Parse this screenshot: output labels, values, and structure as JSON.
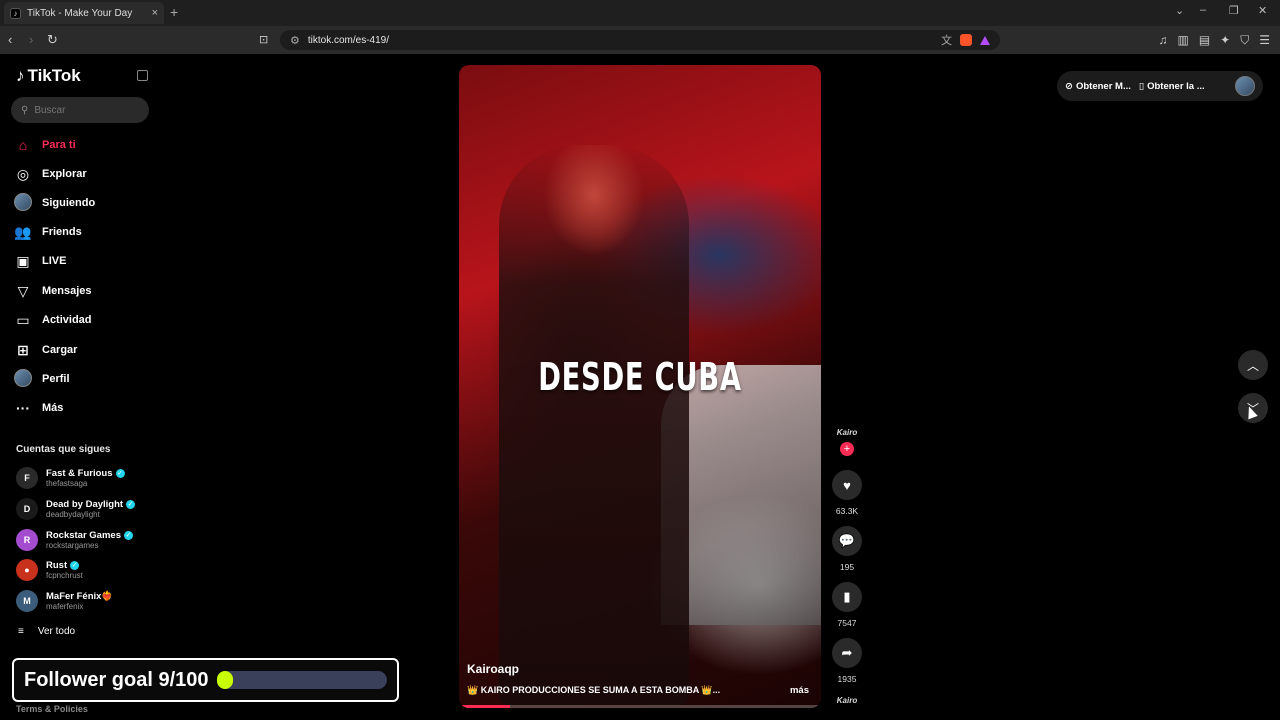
{
  "browser": {
    "tab_title": "TikTok - Make Your Day",
    "tab_close": "×",
    "new_tab": "+",
    "url": "tiktok.com/es-419/"
  },
  "sidebar": {
    "logo": "TikTok",
    "search_placeholder": "Buscar",
    "nav": [
      {
        "label": "Para ti",
        "icon": "home-icon",
        "glyph": "⌂",
        "active": true
      },
      {
        "label": "Explorar",
        "icon": "compass-icon",
        "glyph": "◎"
      },
      {
        "label": "Siguiendo",
        "icon": "avatar-icon",
        "glyph": ""
      },
      {
        "label": "Friends",
        "icon": "friends-icon",
        "glyph": "👥"
      },
      {
        "label": "LIVE",
        "icon": "live-icon",
        "glyph": "▣"
      },
      {
        "label": "Mensajes",
        "icon": "send-icon",
        "glyph": "▽"
      },
      {
        "label": "Actividad",
        "icon": "activity-icon",
        "glyph": "▭"
      },
      {
        "label": "Cargar",
        "icon": "upload-icon",
        "glyph": "⊞"
      },
      {
        "label": "Perfil",
        "icon": "profile-avatar-icon",
        "glyph": ""
      },
      {
        "label": "Más",
        "icon": "more-icon",
        "glyph": "···"
      }
    ],
    "following_title": "Cuentas que sigues",
    "following": [
      {
        "name": "Fast & Furious",
        "handle": "thefastsaga",
        "verified": true,
        "color": "#2a2a2a",
        "mark": "F"
      },
      {
        "name": "Dead by Daylight",
        "handle": "deadbydaylight",
        "verified": true,
        "color": "#1a1a1a",
        "mark": "D"
      },
      {
        "name": "Rockstar Games",
        "handle": "rockstargames",
        "verified": true,
        "color": "#a44ccf",
        "mark": "R"
      },
      {
        "name": "Rust",
        "handle": "fcpnchrust",
        "verified": true,
        "color": "#c8321d",
        "mark": "●"
      },
      {
        "name": "MaFer Fénix❤️‍🔥",
        "handle": "maferfenix",
        "verified": false,
        "color": "#3b5c7a",
        "mark": "M"
      }
    ],
    "see_all": "Ver todo",
    "terms": "Terms & Policies"
  },
  "follower_goal": {
    "label": "Follower goal 9/100",
    "current": 9,
    "target": 100,
    "fill_color": "#c8ff00"
  },
  "video": {
    "overlay_text": "DESDE CUBA",
    "author": "Kairoaqp",
    "caption": "👑 KAIRO PRODUCCIONES SE SUMA A ESTA BOMBA 👑...",
    "more": "más",
    "creator_tag": "Kairo",
    "likes": "63.3K",
    "comments": "195",
    "saves": "7547",
    "shares": "1935",
    "disc_tag": "Kairo",
    "playback_progress": 0.14
  },
  "top_right": {
    "get_coins": "Obtener M...",
    "get_app": "Obtener la ..."
  }
}
